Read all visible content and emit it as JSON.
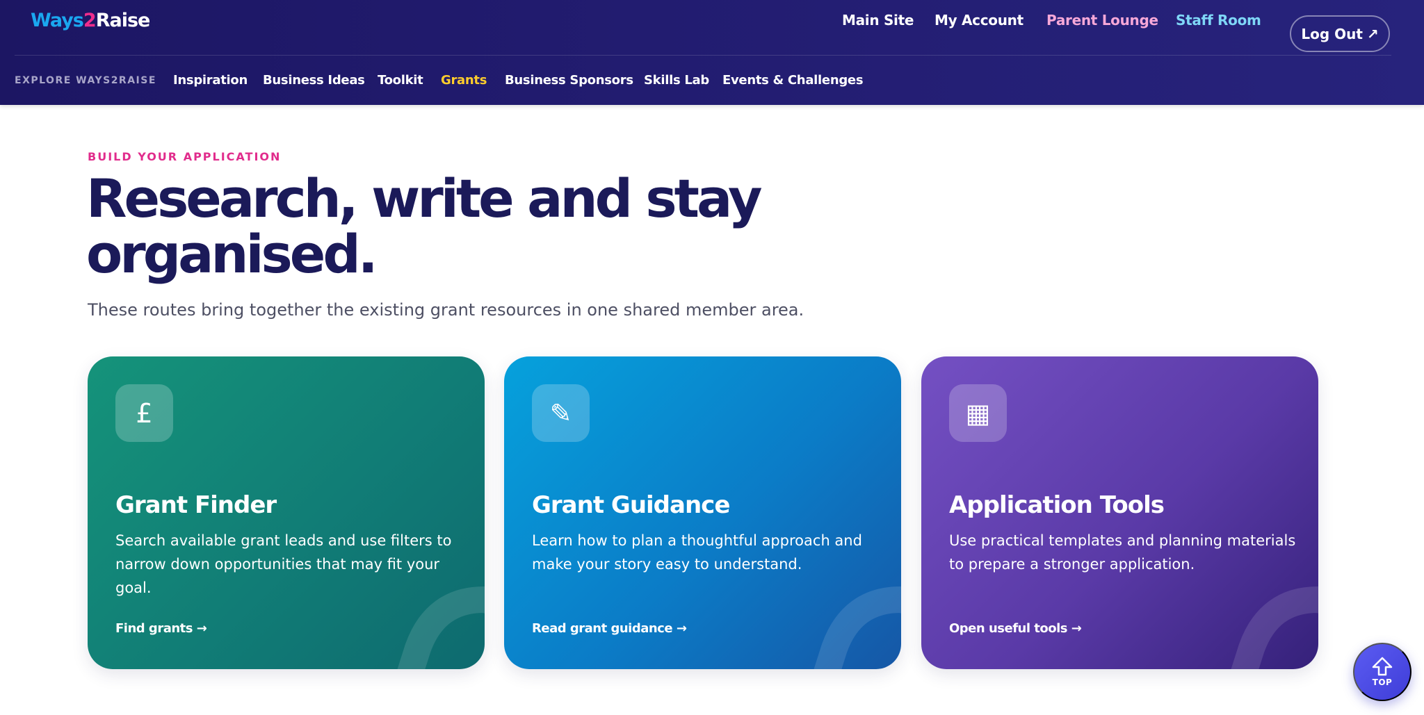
{
  "header": {
    "logo": {
      "part1": "Ways",
      "part2": "2",
      "part3": "Raise"
    },
    "top_links": {
      "main_site": "Main Site",
      "my_account": "My Account",
      "parent_lounge": "Parent Lounge",
      "staff_room": "Staff Room"
    },
    "logout": {
      "label": "Log Out",
      "icon": "↗"
    },
    "explore_label": "EXPLORE WAYS2RAISE",
    "subnav": [
      {
        "label": "Inspiration",
        "active": false
      },
      {
        "label": "Business Ideas",
        "active": false
      },
      {
        "label": "Toolkit",
        "active": false
      },
      {
        "label": "Grants",
        "active": true
      },
      {
        "label": "Business Sponsors",
        "active": false
      },
      {
        "label": "Skills Lab",
        "active": false
      },
      {
        "label": "Events & Challenges",
        "active": false
      }
    ]
  },
  "main": {
    "eyebrow": "BUILD YOUR APPLICATION",
    "headline_line1": "Research, write and stay",
    "headline_line2": "organised.",
    "lead": "These routes bring together the existing grant resources in one shared member area."
  },
  "cards": [
    {
      "icon": "£",
      "icon_name": "pound-icon",
      "title": "Grant Finder",
      "description": "Search available grant leads and use filters to narrow down opportunities that may fit your goal.",
      "link": "Find grants →"
    },
    {
      "icon": "✎",
      "icon_name": "pencil-icon",
      "title": "Grant Guidance",
      "description": "Learn how to plan a thoughtful approach and make your story easy to understand.",
      "link": "Read grant guidance →"
    },
    {
      "icon": "▦",
      "icon_name": "grid-icon",
      "title": "Application Tools",
      "description": "Use practical templates and planning materials to prepare a stronger application.",
      "link": "Open useful tools →"
    }
  ],
  "back_to_top": {
    "label": "TOP"
  },
  "colors": {
    "header_bg": "#1c1663",
    "accent_pink": "#e12c8c",
    "active_nav": "#ffcd2c",
    "card_green": "#15937a",
    "card_blue": "#0b7cc7",
    "card_purple": "#5a3aa7"
  }
}
